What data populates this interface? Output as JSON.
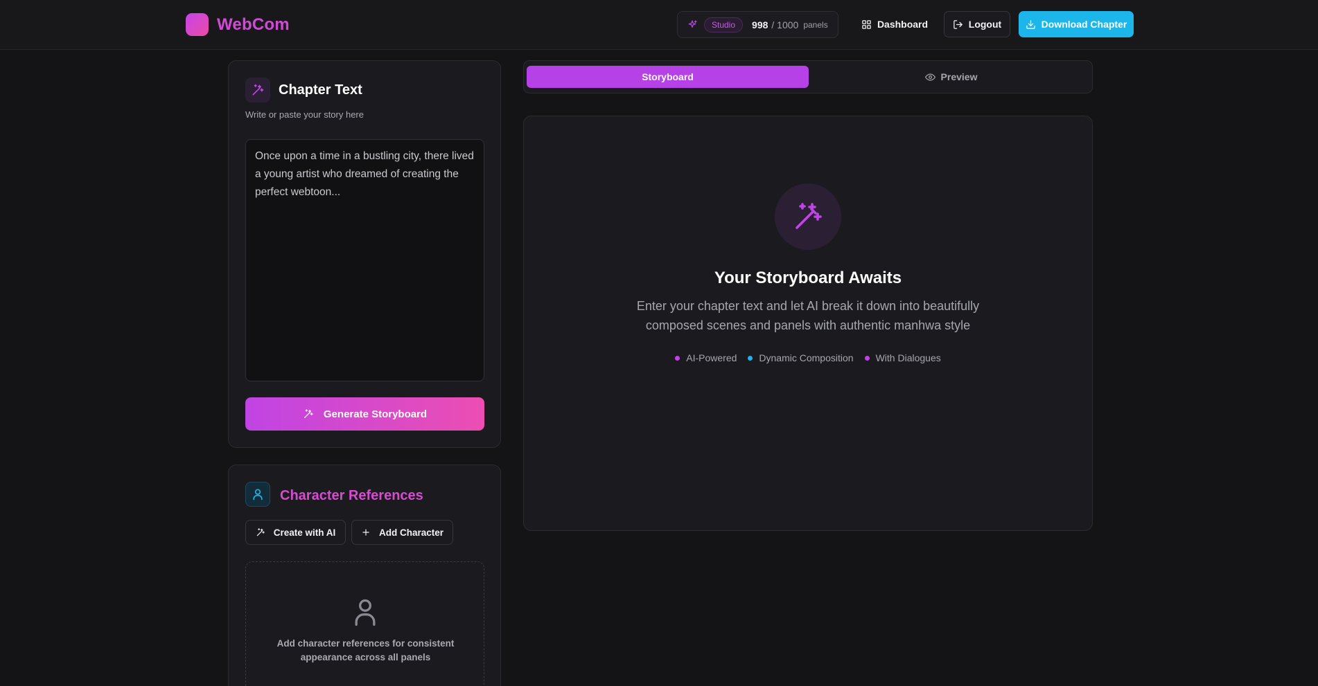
{
  "header": {
    "brand": "WebCom",
    "plan_badge": "Studio",
    "credits_used": "998",
    "credits_total": "/ 1000",
    "credits_unit": "panels",
    "dashboard_label": "Dashboard",
    "logout_label": "Logout",
    "download_label": "Download Chapter"
  },
  "chapter": {
    "title": "Chapter Text",
    "subtitle": "Write or paste your story here",
    "placeholder": "Once upon a time in a bustling city, there lived a young artist who dreamed of creating the perfect webtoon...",
    "generate_label": "Generate Storyboard"
  },
  "characters": {
    "title": "Character References",
    "create_ai_label": "Create with AI",
    "add_label": "Add Character",
    "empty_text": "Add character references for consistent appearance across all panels"
  },
  "tabs": {
    "storyboard": "Storyboard",
    "preview": "Preview"
  },
  "storyboard": {
    "empty_title": "Your Storyboard Awaits",
    "empty_desc": "Enter your chapter text and let AI break it down into beautifully composed scenes and panels with authentic manhwa style",
    "features": [
      "AI-Powered",
      "Dynamic Composition",
      "With Dialogues"
    ]
  },
  "colors": {
    "accent_purple": "#b641e6",
    "accent_pink": "#ec4eb2",
    "accent_cyan": "#1cb6ea",
    "background": "#141417",
    "card": "#1b1b1f"
  }
}
